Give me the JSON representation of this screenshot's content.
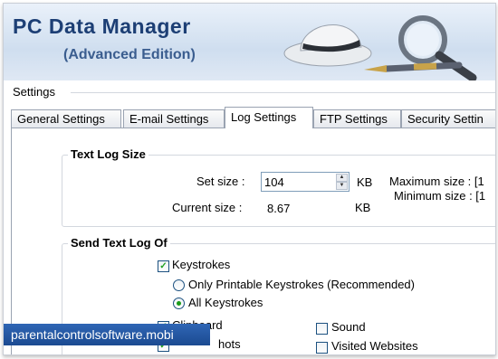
{
  "header": {
    "title": "PC Data Manager",
    "subtitle": "(Advanced Edition)"
  },
  "settings_label": "Settings",
  "tabs": [
    {
      "label": "General Settings"
    },
    {
      "label": "E-mail Settings"
    },
    {
      "label": "Log Settings"
    },
    {
      "label": "FTP Settings"
    },
    {
      "label": "Security Settin"
    }
  ],
  "active_tab": "Log Settings",
  "text_log_size": {
    "title": "Text Log Size",
    "set_size_label": "Set size :",
    "set_size_value": "104",
    "set_size_unit": "KB",
    "current_size_label": "Current size :",
    "current_size_value": "8.67",
    "current_size_unit": "KB",
    "max_size": "Maximum size : [1",
    "min_size": "Minimum size : [1"
  },
  "send_text_log": {
    "title": "Send Text Log Of",
    "keystrokes": {
      "label": "Keystrokes",
      "checked": true
    },
    "option_printable": {
      "label": "Only Printable Keystrokes (Recommended)",
      "selected": false
    },
    "option_all": {
      "label": "All Keystrokes",
      "selected": true
    },
    "clipboard": {
      "label": "Clipboard",
      "checked": true
    },
    "screenshots": {
      "label": "hots",
      "checked": true
    },
    "sound": {
      "label": "Sound",
      "checked": false
    },
    "visited_websites": {
      "label": "Visited Websites",
      "checked": false
    }
  },
  "watermark": "parentalcontrolsoftware.mobi"
}
